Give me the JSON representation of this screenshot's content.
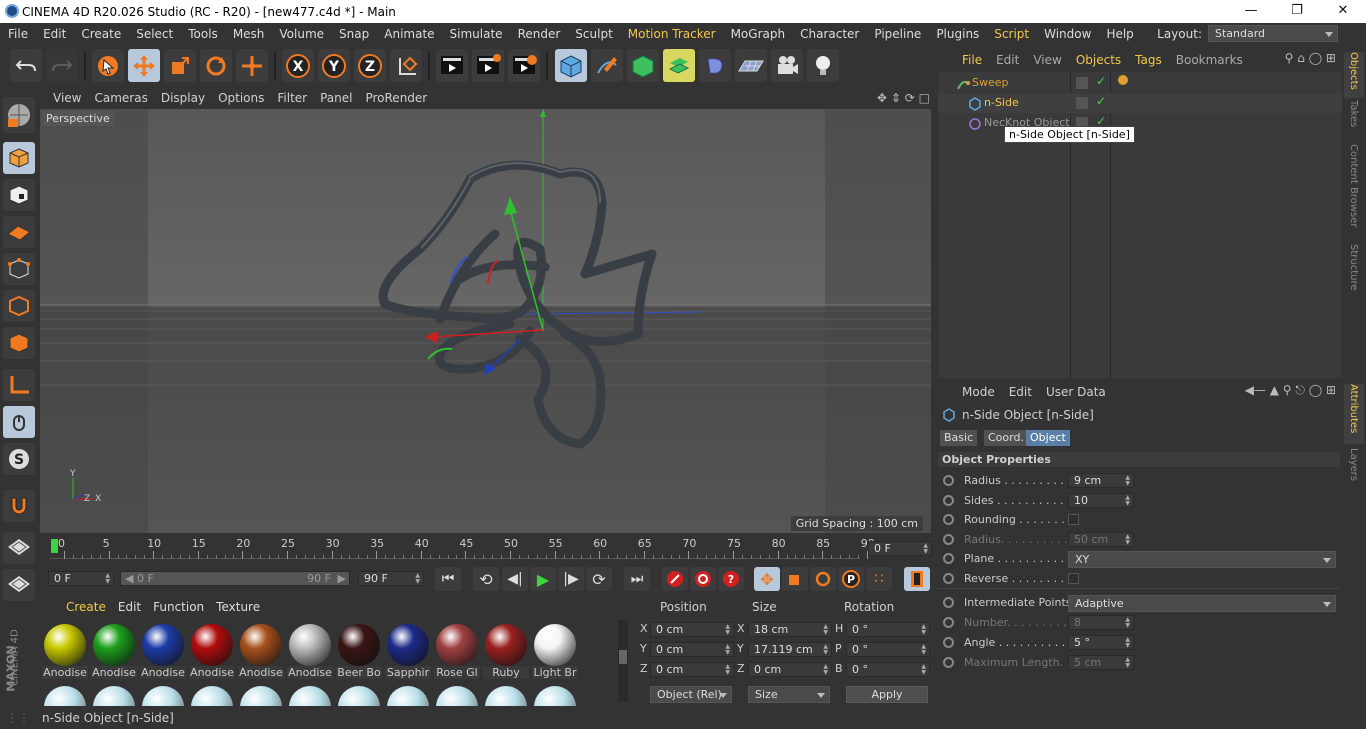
{
  "window": {
    "title": "CINEMA 4D R20.026 Studio (RC - R20) - [new477.c4d *] - Main"
  },
  "menu": [
    "File",
    "Edit",
    "Create",
    "Select",
    "Tools",
    "Mesh",
    "Volume",
    "Snap",
    "Animate",
    "Simulate",
    "Render",
    "Sculpt",
    "Motion Tracker",
    "MoGraph",
    "Character",
    "Pipeline",
    "Plugins",
    "Script",
    "Window",
    "Help"
  ],
  "layout": {
    "label": "Layout:",
    "value": "Standard"
  },
  "viewport": {
    "menu": [
      "View",
      "Cameras",
      "Display",
      "Options",
      "Filter",
      "Panel",
      "ProRender"
    ],
    "label": "Perspective",
    "grid_spacing": "Grid Spacing : 100 cm",
    "axis_y": "Y",
    "axis_x": "X",
    "axis_z": "Z"
  },
  "timeline": {
    "ticks": [
      "0",
      "5",
      "10",
      "15",
      "20",
      "25",
      "30",
      "35",
      "40",
      "45",
      "50",
      "55",
      "60",
      "65",
      "70",
      "75",
      "80",
      "85",
      "90"
    ],
    "current": "0 F",
    "start": "0 F",
    "range_start": "0 F",
    "range_end": "90 F",
    "end": "90 F"
  },
  "materials": {
    "menu": [
      "Create",
      "Edit",
      "Function",
      "Texture"
    ],
    "items": [
      {
        "name": "Anodise",
        "color": "#c8c800"
      },
      {
        "name": "Anodise",
        "color": "#1ca01c"
      },
      {
        "name": "Anodise",
        "color": "#1c3ca8"
      },
      {
        "name": "Anodise",
        "color": "#b00c0c"
      },
      {
        "name": "Anodise",
        "color": "#a8501c"
      },
      {
        "name": "Anodise",
        "color": "#bdbdbd"
      },
      {
        "name": "Beer Bo",
        "color": "#3a1414"
      },
      {
        "name": "Sapphir",
        "color": "#1c2a8a"
      },
      {
        "name": "Rose Gl",
        "color": "#a04040"
      },
      {
        "name": "Ruby",
        "color": "#9a2020"
      },
      {
        "name": "Light Br",
        "color": "#f4f4f4"
      }
    ]
  },
  "coords": {
    "headers": [
      "Position",
      "Size",
      "Rotation"
    ],
    "rows": [
      {
        "pl": "X",
        "pv": "0 cm",
        "sl": "X",
        "sv": "18 cm",
        "rl": "H",
        "rv": "0 °"
      },
      {
        "pl": "Y",
        "pv": "0 cm",
        "sl": "Y",
        "sv": "17.119 cm",
        "rl": "P",
        "rv": "0 °"
      },
      {
        "pl": "Z",
        "pv": "0 cm",
        "sl": "Z",
        "sv": "0 cm",
        "rl": "B",
        "rv": "0 °"
      }
    ],
    "mode": "Object (Rel)",
    "size_mode": "Size",
    "apply": "Apply"
  },
  "objects": {
    "menu": [
      "File",
      "Edit",
      "View",
      "Objects",
      "Tags",
      "Bookmarks"
    ],
    "items": [
      {
        "name": "Sweep",
        "color": "#e0a030"
      },
      {
        "name": "n-Side",
        "color": "#f0c84c"
      },
      {
        "name": "NecKnot Object",
        "color": "#999999"
      }
    ],
    "tooltip": "n-Side Object [n-Side]"
  },
  "attributes": {
    "menu": [
      "Mode",
      "Edit",
      "User Data"
    ],
    "title": "n-Side Object [n-Side]",
    "tabs": [
      "Basic",
      "Coord.",
      "Object"
    ],
    "section": "Object Properties",
    "props": [
      {
        "label": "Radius . . . . . . . . . .",
        "value": "9 cm",
        "dis": false
      },
      {
        "label": "Sides . . . . . . . . . . . .",
        "value": "10",
        "dis": false
      },
      {
        "label": "Rounding . . . . . . . . .",
        "value": "",
        "dis": false
      },
      {
        "label": "Radius. . . . . . . . . . .",
        "value": "50 cm",
        "dis": true
      },
      {
        "label": "Plane . . . . . . . . . . . .",
        "value": "XY",
        "dis": false
      },
      {
        "label": "Reverse . . . . . . . . . .",
        "value": "",
        "dis": false
      }
    ],
    "props2": [
      {
        "label": "Intermediate Points",
        "value": "Adaptive",
        "dis": false
      },
      {
        "label": "Number. . . . . . . . . . .",
        "value": "8",
        "dis": true
      },
      {
        "label": "Angle . . . . . . . . . . . .",
        "value": "5 °",
        "dis": false
      },
      {
        "label": "Maximum Length. . .",
        "value": "5 cm",
        "dis": true
      }
    ]
  },
  "right_tabs": [
    "Objects",
    "Takes",
    "Content Browser",
    "Structure",
    "Attributes",
    "Layers"
  ],
  "brand": [
    "MAXON",
    "CINEMA 4D"
  ],
  "status": "n-Side Object [n-Side]"
}
